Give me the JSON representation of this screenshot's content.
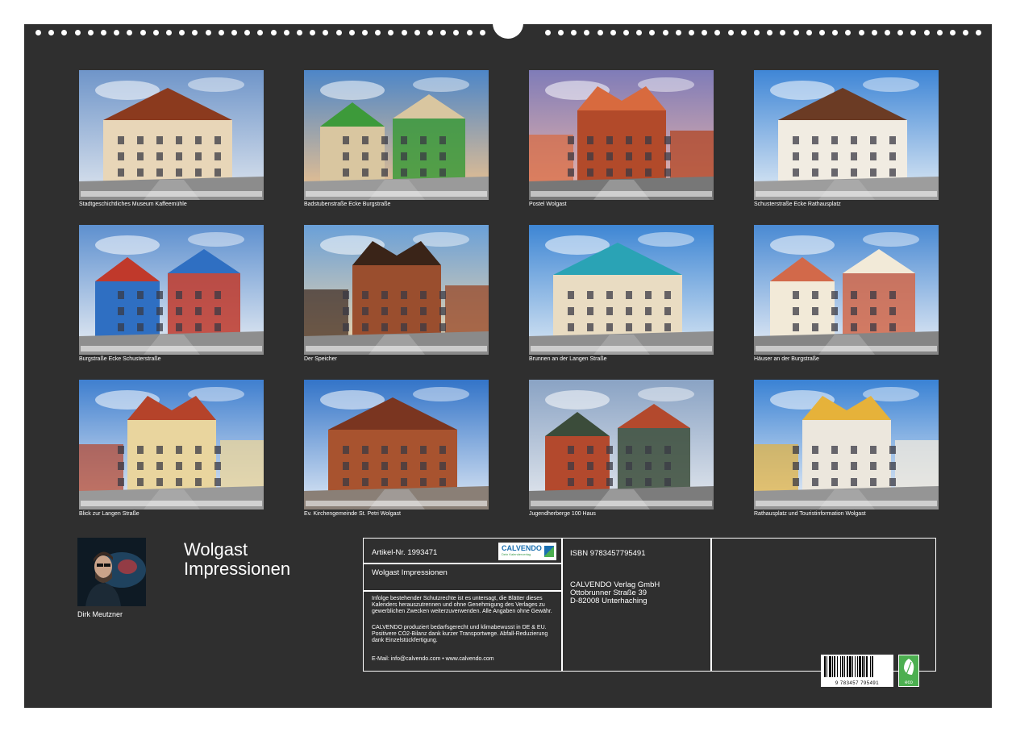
{
  "photos": [
    {
      "caption": "Stadtgeschichtliches Museum Kaffeemühle",
      "sky_top": "#6f95c9",
      "sky_bottom": "#dfe6ef",
      "building": "#e8d6b8",
      "accent": "#8b3a1e",
      "ground": "#8c8c8c"
    },
    {
      "caption": "Badstubenstraße Ecke Burgstraße",
      "sky_top": "#4d86c8",
      "sky_bottom": "#f3c48c",
      "building": "#d9c6a0",
      "accent": "#3d9a3a",
      "ground": "#9a9a9a"
    },
    {
      "caption": "Postel Wolgast",
      "sky_top": "#7f7cb8",
      "sky_bottom": "#f0b7a8",
      "building": "#b24a2a",
      "accent": "#d86a3e",
      "ground": "#777777"
    },
    {
      "caption": "Schusterstraße Ecke Rathausplatz",
      "sky_top": "#3f86d6",
      "sky_bottom": "#e2ecf5",
      "building": "#f1ece2",
      "accent": "#6b3b24",
      "ground": "#9d9d9d"
    },
    {
      "caption": "Burgstraße Ecke Schusterstraße",
      "sky_top": "#5e90cf",
      "sky_bottom": "#e9eef4",
      "building": "#2f6fc2",
      "accent": "#c0392b",
      "ground": "#8e8e8e"
    },
    {
      "caption": "Der Speicher",
      "sky_top": "#6aa0d8",
      "sky_bottom": "#f4d7a8",
      "building": "#9a4e2e",
      "accent": "#3a2418",
      "ground": "#8a8a8a"
    },
    {
      "caption": "Brunnen an der Langen Straße",
      "sky_top": "#3e86d4",
      "sky_bottom": "#dbe8f4",
      "building": "#e9dcc2",
      "accent": "#2aa3b5",
      "ground": "#8f8f8f"
    },
    {
      "caption": "Häuser an der Burgstraße",
      "sky_top": "#4a8ad3",
      "sky_bottom": "#e8eef6",
      "building": "#f2ead8",
      "accent": "#d2694a",
      "ground": "#858585"
    },
    {
      "caption": "Blick zur Langen Straße",
      "sky_top": "#3f7fcf",
      "sky_bottom": "#e9eef5",
      "building": "#e9d59e",
      "accent": "#b5432a",
      "ground": "#999999"
    },
    {
      "caption": "Ev. Kirchengemeinde St. Petri Wolgast",
      "sky_top": "#3374c8",
      "sky_bottom": "#dfe9f5",
      "building": "#a8532f",
      "accent": "#7a3520",
      "ground": "#8a7f76"
    },
    {
      "caption": "Jugendherberge 100 Haus",
      "sky_top": "#8aa3c4",
      "sky_bottom": "#e5e9ef",
      "building": "#b3492d",
      "accent": "#3b4c3a",
      "ground": "#7c7c7c"
    },
    {
      "caption": "Rathausplatz und Touristinformation Wolgast",
      "sky_top": "#3a82d4",
      "sky_bottom": "#eef2f7",
      "building": "#ece7dd",
      "accent": "#e6b23a",
      "ground": "#959595"
    }
  ],
  "author": "Dirk Meutzner",
  "title_line1": "Wolgast",
  "title_line2": "Impressionen",
  "info": {
    "article": "Artikel-Nr. 1993471",
    "logo": "CALVENDO",
    "logo_tag": "Dein Kalenderverlag",
    "product_title": "Wolgast Impressionen",
    "legal": "Infolge bestehender Schutzrechte ist es untersagt, die Blätter dieses Kalenders herauszutrennen und ohne Genehmigung des Verlages zu gewerblichen Zwecken weiterzuverwenden. Alle Angaben ohne Gewähr.",
    "eco_text": "CALVENDO produziert bedarfsgerecht und klimabewusst in DE & EU. Positivere CO2-Bilanz dank kurzer Transportwege. Abfall-Reduzierung dank Einzelstückfertigung.",
    "email": "E-Mail: info@calvendo.com • www.calvendo.com",
    "isbn": "ISBN 9783457795491",
    "publisher": "CALVENDO Verlag GmbH",
    "street": "Ottobrunner Straße 39",
    "city": "D-82008 Unterhaching",
    "barcode_number": "9 783457 795491",
    "eco_label": "eco"
  }
}
